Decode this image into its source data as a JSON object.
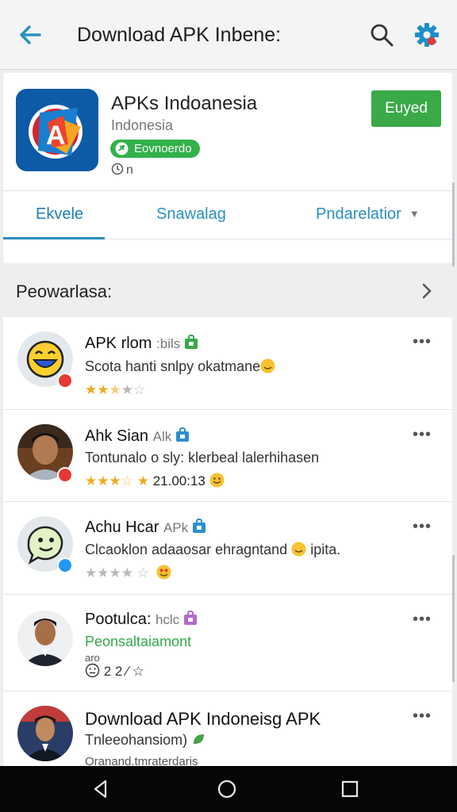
{
  "topbar": {
    "title": "Download APK Inbene:"
  },
  "app": {
    "name": "APKs Indoanesia",
    "subtitle": "Indonesia",
    "badge": "Eovnoerdo",
    "meta": "n",
    "install_label": "Euyed"
  },
  "tabs": [
    {
      "label": "Ekvele"
    },
    {
      "label": "Snawalag"
    },
    {
      "label": "Pndarelatior"
    }
  ],
  "section": {
    "title": "Peowarlasa:"
  },
  "items": [
    {
      "name": "APK rlom",
      "tag": ":bils",
      "desc": "Scota hanti snlpy okatmane",
      "rating_text": "",
      "stars_on": 2.5
    },
    {
      "name": "Ahk Sian",
      "tag": "Alk",
      "desc": "Tontunalo o sly: klerbeal lalerhihasen",
      "rating_text": "21.00:13",
      "stars_on": 3.5
    },
    {
      "name": "Achu Hcar",
      "tag": "APk",
      "desc": "Clcaoklon adaaosar ehragntand",
      "desc2": "ipita.",
      "rating_text": "",
      "stars_on": 0
    },
    {
      "name": "Pootulca:",
      "tag": "hclc",
      "desc": "Peonsaltaiamont",
      "sub": "aro",
      "rating_text": "2 2 ∕ ☆",
      "stars_on": 0
    },
    {
      "name": "Download APK Indoneisg APK",
      "tag": "",
      "desc": "Tnleeohansiom)",
      "rating_text": "Oranand.tmraterdaris",
      "stars_on": 0
    }
  ],
  "colors": {
    "accent": "#2a8fbf",
    "install": "#3aa948",
    "star": "#f2a91f"
  }
}
